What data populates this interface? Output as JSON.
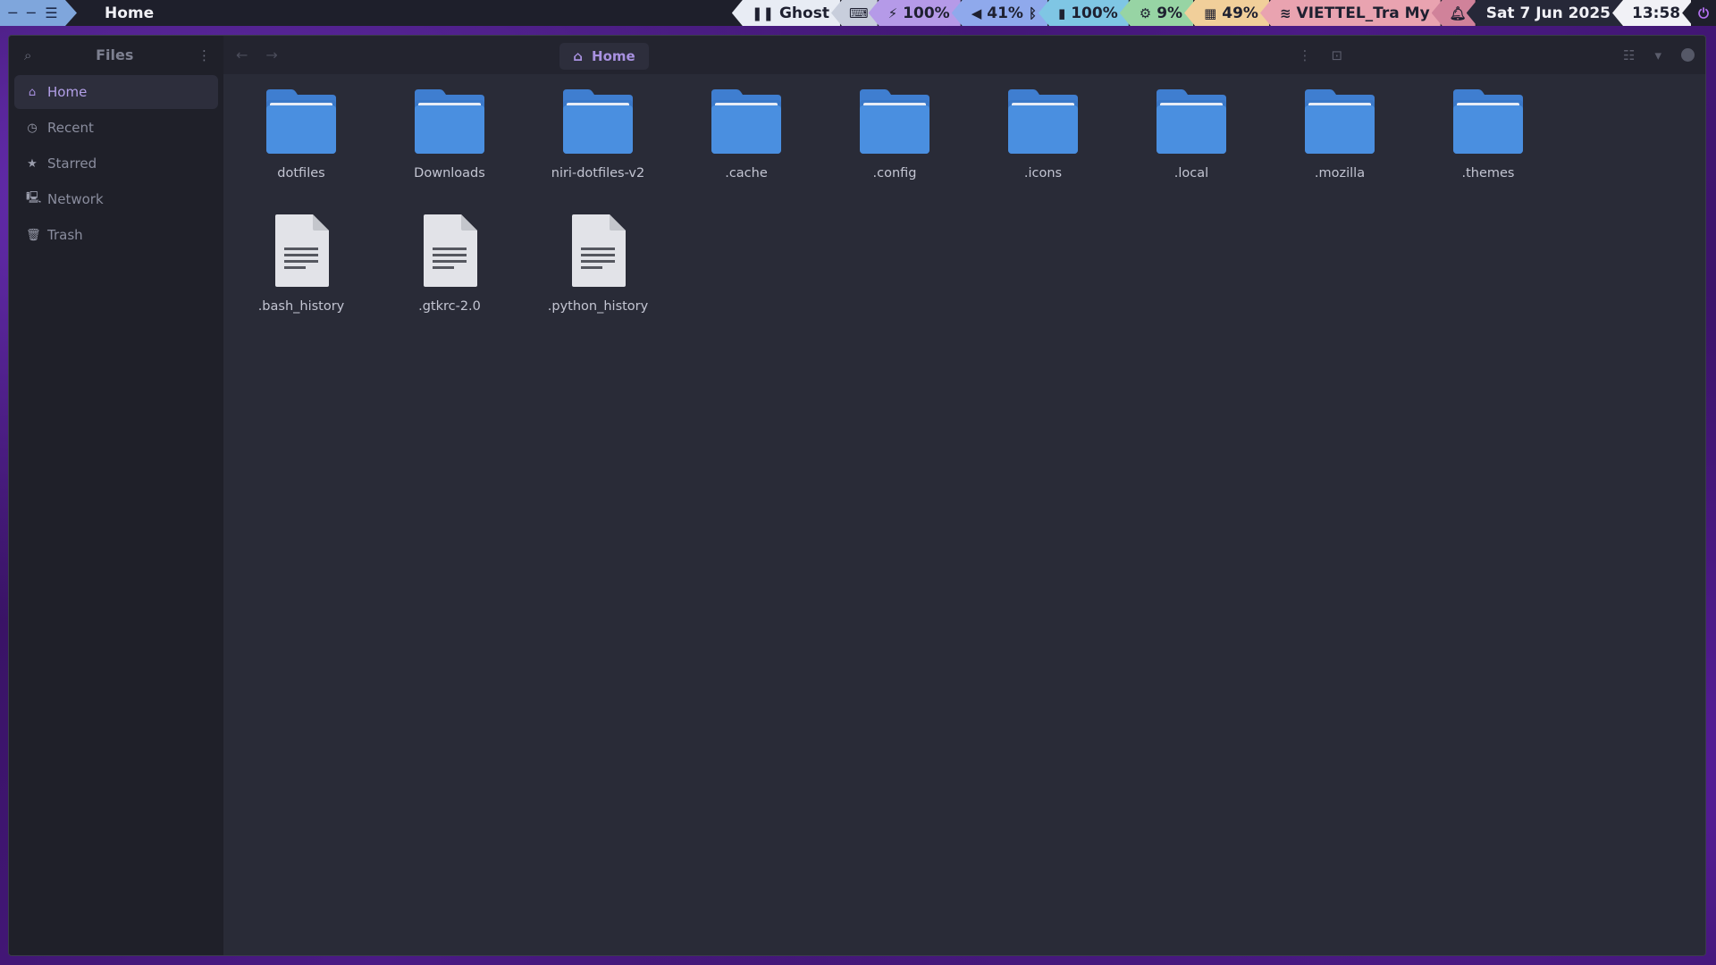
{
  "topbar": {
    "active_title": "Home",
    "ghost_label": "Ghost",
    "power_value": "100%",
    "volume_value": "41%",
    "battery_value": "100%",
    "cpu_value": "9%",
    "memory_value": "49%",
    "wifi_name": "VIETTEL_Tra My",
    "date": "Sat  7 Jun 2025",
    "time": "13:58"
  },
  "sidebar": {
    "title": "Files",
    "items": [
      {
        "label": "Home",
        "icon": "home-icon",
        "active": true
      },
      {
        "label": "Recent",
        "icon": "clock-icon"
      },
      {
        "label": "Starred",
        "icon": "star-icon"
      },
      {
        "label": "Network",
        "icon": "network-icon"
      },
      {
        "label": "Trash",
        "icon": "trash-icon"
      }
    ]
  },
  "header": {
    "path_label": "Home"
  },
  "files": [
    {
      "name": "dotfiles",
      "type": "folder"
    },
    {
      "name": "Downloads",
      "type": "folder"
    },
    {
      "name": "niri-dotfiles-v2",
      "type": "folder"
    },
    {
      "name": ".cache",
      "type": "folder"
    },
    {
      "name": ".config",
      "type": "folder"
    },
    {
      "name": ".icons",
      "type": "folder"
    },
    {
      "name": ".local",
      "type": "folder"
    },
    {
      "name": ".mozilla",
      "type": "folder"
    },
    {
      "name": ".themes",
      "type": "folder"
    },
    {
      "name": ".bash_history",
      "type": "text"
    },
    {
      "name": ".gtkrc-2.0",
      "type": "text"
    },
    {
      "name": ".python_history",
      "type": "text"
    }
  ],
  "colors": {
    "folder_blue": "#4a8fe0",
    "accent_purple": "#a891e0"
  }
}
